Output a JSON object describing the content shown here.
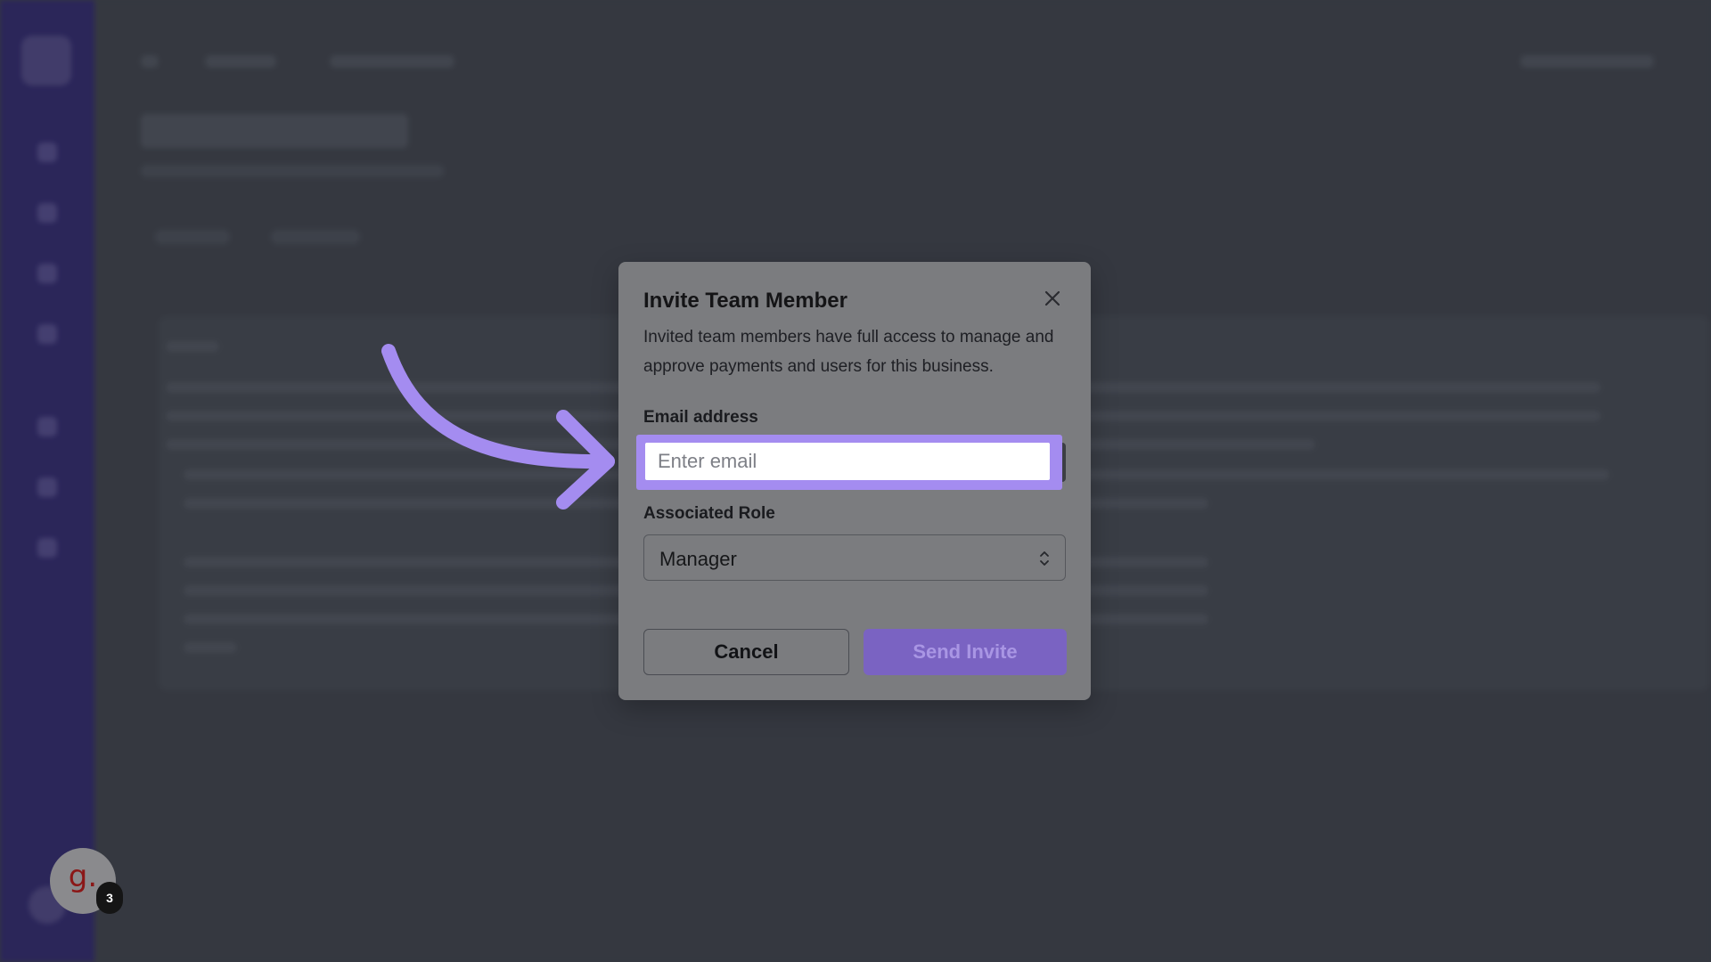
{
  "modal": {
    "title": "Invite Team Member",
    "description": "Invited team members have full access to manage and approve payments and users for this business.",
    "close_icon": "close-icon",
    "email": {
      "label": "Email address",
      "placeholder": "Enter email",
      "value": ""
    },
    "role": {
      "label": "Associated Role",
      "selected": "Manager",
      "icon": "chevron-up-down-icon"
    },
    "buttons": {
      "cancel": "Cancel",
      "send": "Send Invite"
    }
  },
  "guide_badge": {
    "letter": "g.",
    "count": "3"
  },
  "colors": {
    "highlight": "#a48cf0",
    "sidebar": "#2c2466",
    "primary_button": "#7a63c2"
  }
}
